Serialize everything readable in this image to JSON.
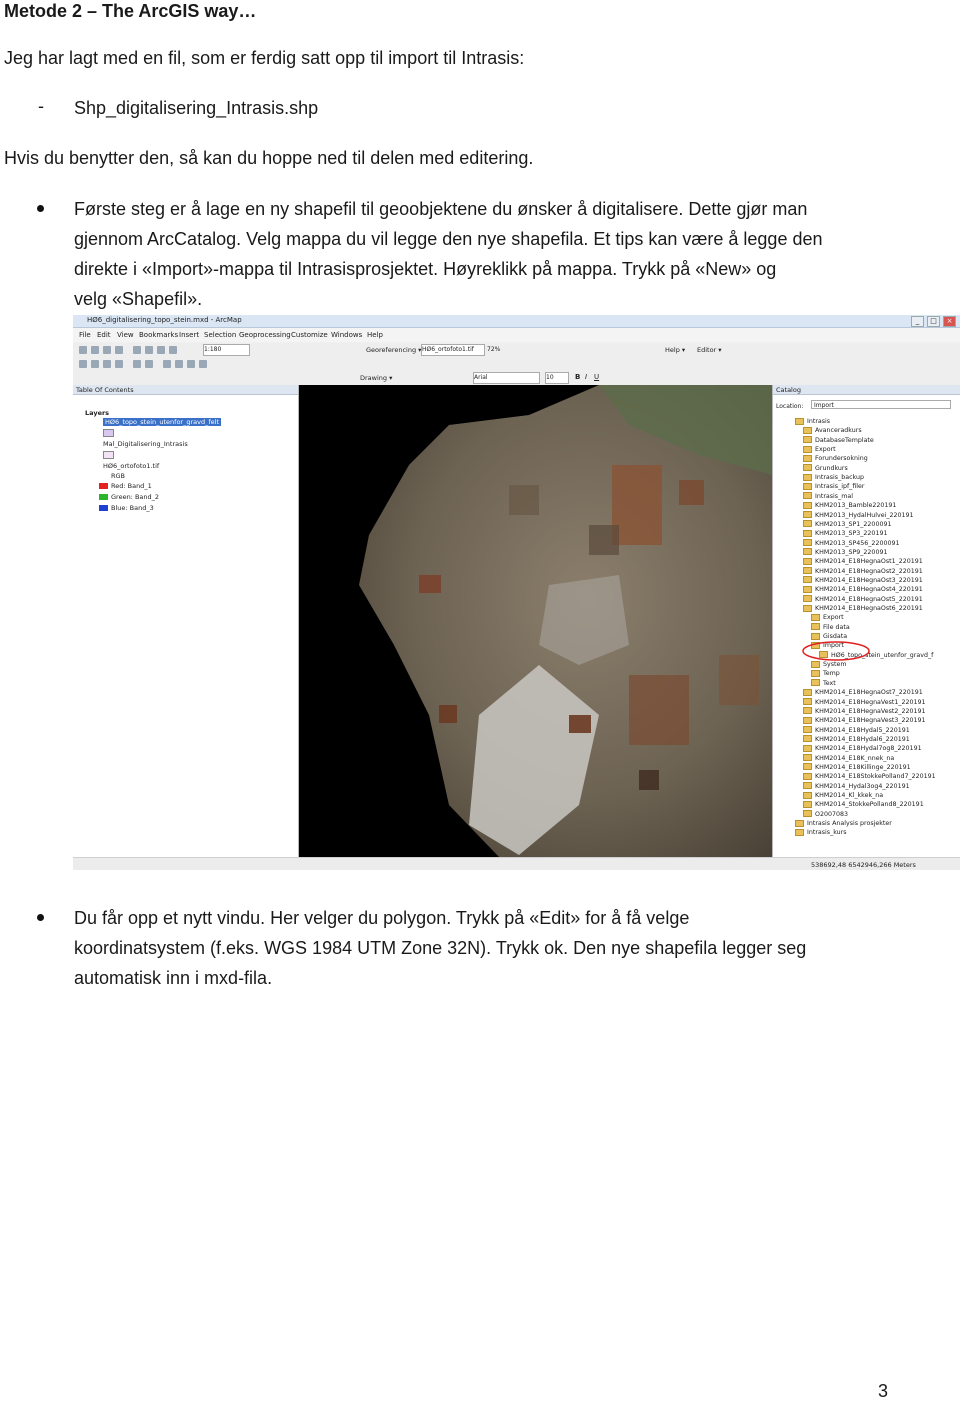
{
  "heading": "Metode 2 – The ArcGIS way…",
  "intro": "Jeg har lagt med en fil, som er ferdig satt opp til import til Intrasis:",
  "file_item": "Shp_digitalisering_Intrasis.shp",
  "skip_note": "Hvis du benytter den, så kan du hoppe ned til delen med editering.",
  "bullet1_lines": [
    "Første steg er å lage en ny shapefil til geoobjektene du ønsker å digitalisere. Dette gjør man",
    "gjennom ArcCatalog. Velg mappa du vil legge den nye shapefila. Et tips kan være å legge den",
    "direkte i «Import»-mappa til Intrasisprosjektet. Høyreklikk på mappa. Trykk på «New» og",
    "velg «Shapefil»."
  ],
  "bullet2_lines": [
    "Du får opp et nytt vindu. Her velger du polygon. Trykk på «Edit» for å få velge",
    "koordinatsystem (f.eks. WGS 1984 UTM Zone 32N). Trykk ok. Den nye shapefila legger seg",
    "automatisk inn i mxd-fila."
  ],
  "page_number": "3",
  "screenshot": {
    "window_title": "HØ6_digitalisering_topo_stein.mxd - ArcMap",
    "menus": [
      "File",
      "Edit",
      "View",
      "Bookmarks",
      "Insert",
      "Selection",
      "Geoprocessing",
      "Customize",
      "Windows",
      "Help"
    ],
    "scale": "1:180",
    "georef_label": "Georeferencing ▾",
    "georef_layer": "HØ6_ortofoto1.tif",
    "zoom_pct": "72%",
    "help_label": "Help ▾",
    "editor_label": "Editor ▾",
    "drawing_label": "Drawing ▾",
    "font_name": "Arial",
    "font_size": "10",
    "toc_title": "Table Of Contents",
    "toc_layers_label": "Layers",
    "toc_layer1": "HØ6_topo_stein_utenfor_gravd_felt",
    "toc_layer2": "Mal_Digitalisering_Intrasis",
    "toc_layer3": "HØ6_ortofoto1.tif",
    "toc_rgb": "RGB",
    "toc_bands": [
      {
        "label": "Red:",
        "band": "Band_1",
        "color": "#e52020"
      },
      {
        "label": "Green:",
        "band": "Band_2",
        "color": "#2ab52a"
      },
      {
        "label": "Blue:",
        "band": "Band_3",
        "color": "#2040d0"
      }
    ],
    "catalog_title": "Catalog",
    "catalog_location_label": "Location:",
    "catalog_location_value": "Import",
    "catalog_items": [
      "Intrasis",
      "Avanceradkurs",
      "DatabaseTemplate",
      "Export",
      "Forundersokning",
      "Grundkurs",
      "Intrasis_backup",
      "Intrasis_ipf_filer",
      "Intrasis_mal",
      "KHM2013_Bamble220191",
      "KHM2013_HydalHulvei_220191",
      "KHM2013_SP1_2200091",
      "KHM2013_SP3_220191",
      "KHM2013_SP456_2200091",
      "KHM2013_SP9_220091",
      "KHM2014_E18HegnaOst1_220191",
      "KHM2014_E18HegnaOst2_220191",
      "KHM2014_E18HegnaOst3_220191",
      "KHM2014_E18HegnaOst4_220191",
      "KHM2014_E18HegnaOst5_220191",
      "KHM2014_E18HegnaOst6_220191",
      "Export",
      "File data",
      "Gisdata",
      "Import",
      "HØ6_topo_stein_utenfor_gravd_f",
      "System",
      "Temp",
      "Text",
      "KHM2014_E18HegnaOst7_220191",
      "KHM2014_E18HegnaVest1_220191",
      "KHM2014_E18HegnaVest2_220191",
      "KHM2014_E18HegnaVest3_220191",
      "KHM2014_E18Hydal5_220191",
      "KHM2014_E18Hydal6_220191",
      "KHM2014_E18Hydal7og8_220191",
      "KHM2014_E18K_nnek_na",
      "KHM2014_E18Killinge_220191",
      "KHM2014_E18StokkePolland7_220191",
      "KHM2014_Hydal3og4_220191",
      "KHM2014_Kl_kkek_na",
      "KHM2014_StokkePolland8_220191",
      "O2007083",
      "Intrasis Analysis prosjekter",
      "Intrasis_kurs"
    ],
    "status_coords": "538692,48  6542946,266 Meters"
  }
}
